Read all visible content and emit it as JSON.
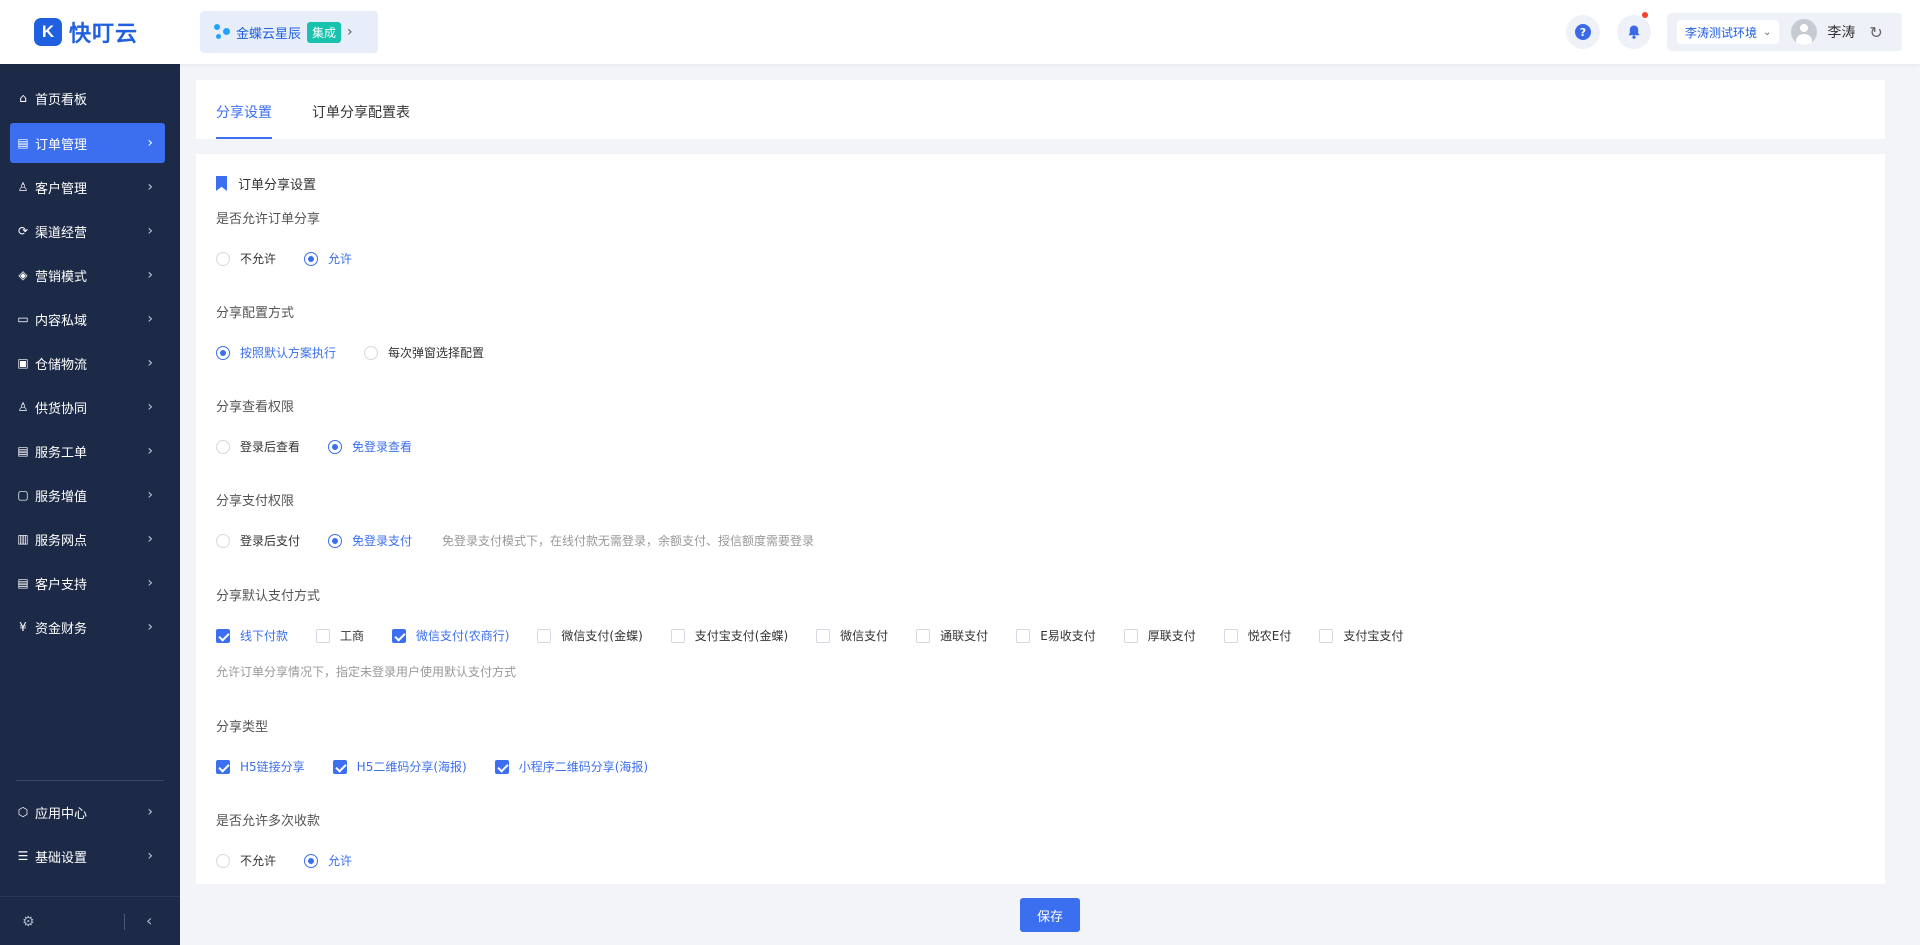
{
  "app": {
    "logo_letter": "K",
    "logo_text": "快叮云"
  },
  "brand": {
    "name": "金蝶云星辰",
    "tag": "集成"
  },
  "header": {
    "env": "李涛测试环境",
    "user": "李涛"
  },
  "sidebar": {
    "items": [
      {
        "label": "首页看板",
        "icon": "⌂"
      },
      {
        "label": "订单管理",
        "icon": "▤"
      },
      {
        "label": "客户管理",
        "icon": "♙"
      },
      {
        "label": "渠道经营",
        "icon": "⟳"
      },
      {
        "label": "营销模式",
        "icon": "◈"
      },
      {
        "label": "内容私域",
        "icon": "▭"
      },
      {
        "label": "仓储物流",
        "icon": "▣"
      },
      {
        "label": "供货协同",
        "icon": "♙"
      },
      {
        "label": "服务工单",
        "icon": "▤"
      },
      {
        "label": "服务增值",
        "icon": "▢"
      },
      {
        "label": "服务网点",
        "icon": "▥"
      },
      {
        "label": "客户支持",
        "icon": "▤"
      },
      {
        "label": "资金财务",
        "icon": "¥"
      }
    ],
    "bottom_items": [
      {
        "label": "应用中心",
        "icon": "⬡"
      },
      {
        "label": "基础设置",
        "icon": "☰"
      }
    ]
  },
  "tabs": [
    "分享设置",
    "订单分享配置表"
  ],
  "section_title": "订单分享设置",
  "fields": {
    "allow_share": {
      "label": "是否允许订单分享",
      "options": [
        "不允许",
        "允许"
      ],
      "selected": 1
    },
    "config_mode": {
      "label": "分享配置方式",
      "options": [
        "按照默认方案执行",
        "每次弹窗选择配置"
      ],
      "selected": 0
    },
    "view_perm": {
      "label": "分享查看权限",
      "options": [
        "登录后查看",
        "免登录查看"
      ],
      "selected": 1
    },
    "pay_perm": {
      "label": "分享支付权限",
      "options": [
        "登录后支付",
        "免登录支付"
      ],
      "selected": 1,
      "hint": "免登录支付模式下，在线付款无需登录，余额支付、授信额度需要登录"
    },
    "default_pay": {
      "label": "分享默认支付方式",
      "options": [
        "线下付款",
        "工商",
        "微信支付(农商行)",
        "微信支付(金蝶)",
        "支付宝支付(金蝶)",
        "微信支付",
        "通联支付",
        "E易收支付",
        "厚联支付",
        "悦农E付",
        "支付宝支付"
      ],
      "checked": [
        true,
        false,
        true,
        false,
        false,
        false,
        false,
        false,
        false,
        false,
        false
      ],
      "hint": "允许订单分享情况下，指定未登录用户使用默认支付方式"
    },
    "share_type": {
      "label": "分享类型",
      "options": [
        "H5链接分享",
        "H5二维码分享(海报)",
        "小程序二维码分享(海报)"
      ],
      "checked": [
        true,
        true,
        true
      ]
    },
    "multi_collect": {
      "label": "是否允许多次收款",
      "options": [
        "不允许",
        "允许"
      ],
      "selected": 1
    }
  },
  "actions": {
    "save": "保存"
  },
  "colors": {
    "primary": "#3b6ff0",
    "sidebar_bg": "#1c2a47",
    "brand_tag": "#19c2ae"
  }
}
